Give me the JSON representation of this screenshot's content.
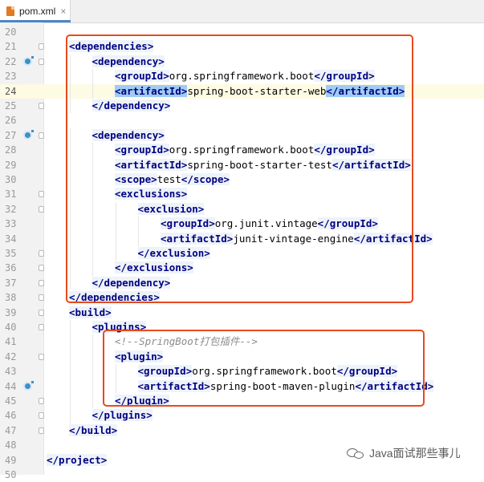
{
  "tab": {
    "title": "pom.xml",
    "icon": "xml-file-icon",
    "close_glyph": "×"
  },
  "lines": [
    {
      "n": "20",
      "indent": 0,
      "parts": []
    },
    {
      "n": "21",
      "indent": 1,
      "parts": [
        [
          "t",
          "<dependencies>"
        ]
      ]
    },
    {
      "n": "22",
      "indent": 2,
      "parts": [
        [
          "t",
          "<dependency>"
        ]
      ],
      "icon": true
    },
    {
      "n": "23",
      "indent": 3,
      "parts": [
        [
          "t",
          "<groupId>"
        ],
        [
          "x",
          "org.springframework.boot"
        ],
        [
          "t",
          "</groupId>"
        ]
      ]
    },
    {
      "n": "24",
      "indent": 3,
      "parts": [
        [
          "h",
          "<artifactId>"
        ],
        [
          "x",
          "spring-boot-starter-web"
        ],
        [
          "h",
          "</artifactId>"
        ]
      ],
      "current": true
    },
    {
      "n": "25",
      "indent": 2,
      "parts": [
        [
          "t",
          "</dependency>"
        ]
      ]
    },
    {
      "n": "26",
      "indent": 0,
      "parts": []
    },
    {
      "n": "27",
      "indent": 2,
      "parts": [
        [
          "t",
          "<dependency>"
        ]
      ],
      "icon": true
    },
    {
      "n": "28",
      "indent": 3,
      "parts": [
        [
          "t",
          "<groupId>"
        ],
        [
          "x",
          "org.springframework.boot"
        ],
        [
          "t",
          "</groupId>"
        ]
      ]
    },
    {
      "n": "29",
      "indent": 3,
      "parts": [
        [
          "t",
          "<artifactId>"
        ],
        [
          "x",
          "spring-boot-starter-test"
        ],
        [
          "t",
          "</artifactId>"
        ]
      ]
    },
    {
      "n": "30",
      "indent": 3,
      "parts": [
        [
          "t",
          "<scope>"
        ],
        [
          "x",
          "test"
        ],
        [
          "t",
          "</scope>"
        ]
      ]
    },
    {
      "n": "31",
      "indent": 3,
      "parts": [
        [
          "t",
          "<exclusions>"
        ]
      ]
    },
    {
      "n": "32",
      "indent": 4,
      "parts": [
        [
          "t",
          "<exclusion>"
        ]
      ]
    },
    {
      "n": "33",
      "indent": 5,
      "parts": [
        [
          "t",
          "<groupId>"
        ],
        [
          "x",
          "org.junit.vintage"
        ],
        [
          "t",
          "</groupId>"
        ]
      ]
    },
    {
      "n": "34",
      "indent": 5,
      "parts": [
        [
          "t",
          "<artifactId>"
        ],
        [
          "x",
          "junit-vintage-engine"
        ],
        [
          "t",
          "</artifactId>"
        ]
      ]
    },
    {
      "n": "35",
      "indent": 4,
      "parts": [
        [
          "t",
          "</exclusion>"
        ]
      ]
    },
    {
      "n": "36",
      "indent": 3,
      "parts": [
        [
          "t",
          "</exclusions>"
        ]
      ]
    },
    {
      "n": "37",
      "indent": 2,
      "parts": [
        [
          "t",
          "</dependency>"
        ]
      ]
    },
    {
      "n": "38",
      "indent": 1,
      "parts": [
        [
          "t",
          "</dependencies>"
        ]
      ]
    },
    {
      "n": "39",
      "indent": 1,
      "parts": [
        [
          "t",
          "<build>"
        ]
      ]
    },
    {
      "n": "40",
      "indent": 2,
      "parts": [
        [
          "t",
          "<plugins>"
        ]
      ]
    },
    {
      "n": "41",
      "indent": 3,
      "parts": [
        [
          "c",
          "<!--SpringBoot打包插件-->"
        ]
      ]
    },
    {
      "n": "42",
      "indent": 3,
      "parts": [
        [
          "t",
          "<plugin>"
        ]
      ]
    },
    {
      "n": "43",
      "indent": 4,
      "parts": [
        [
          "t",
          "<groupId>"
        ],
        [
          "x",
          "org.springframework.boot"
        ],
        [
          "t",
          "</groupId>"
        ]
      ]
    },
    {
      "n": "44",
      "indent": 4,
      "parts": [
        [
          "t",
          "<artifactId>"
        ],
        [
          "x",
          "spring-boot-maven-plugin"
        ],
        [
          "t",
          "</artifactId>"
        ]
      ],
      "icon": true
    },
    {
      "n": "45",
      "indent": 3,
      "parts": [
        [
          "t",
          "</plugin>"
        ]
      ]
    },
    {
      "n": "46",
      "indent": 2,
      "parts": [
        [
          "t",
          "</plugins>"
        ]
      ]
    },
    {
      "n": "47",
      "indent": 1,
      "parts": [
        [
          "t",
          "</build>"
        ]
      ]
    },
    {
      "n": "48",
      "indent": 0,
      "parts": []
    },
    {
      "n": "49",
      "indent": 0,
      "parts": [
        [
          "t",
          "</project>"
        ]
      ]
    },
    {
      "n": "50",
      "indent": 0,
      "parts": []
    }
  ],
  "watermark": {
    "text": "Java面试那些事儿",
    "icon": "wechat-icon"
  },
  "colors": {
    "tag": "#000080",
    "highlight": "#9fccf5",
    "box": "#e84a1f",
    "comment": "#8c8c8c"
  }
}
